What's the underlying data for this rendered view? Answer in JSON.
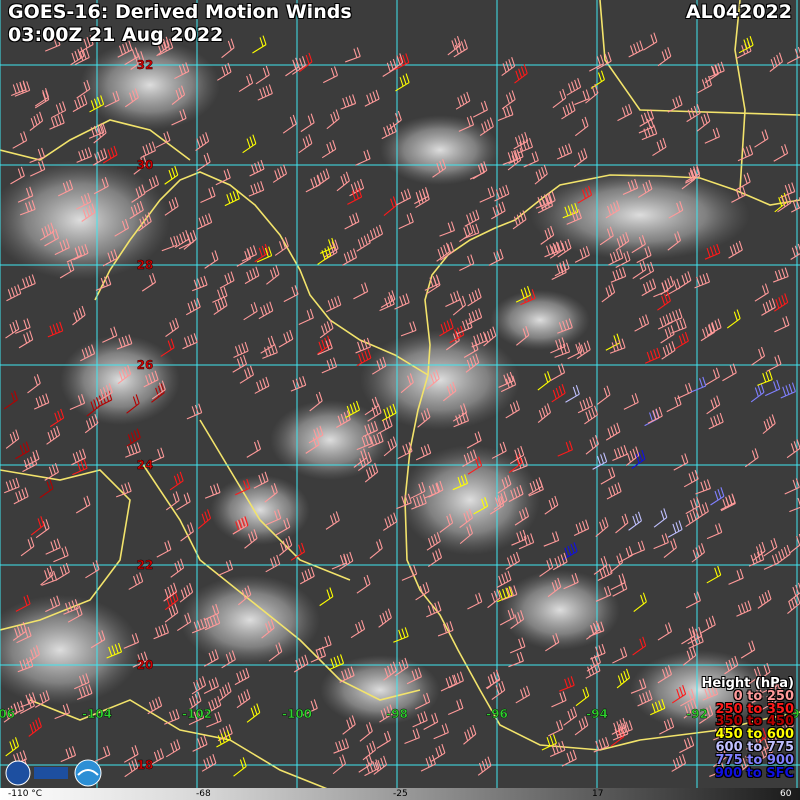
{
  "header": {
    "title": "GOES-16: Derived Motion Winds",
    "time": "03:00Z 21 Aug 2022",
    "storm_id": "AL042022"
  },
  "map": {
    "lat_labels": [
      "32",
      "30",
      "28",
      "26",
      "24",
      "22",
      "20",
      "18"
    ],
    "lon_labels": [
      "-106",
      "-104",
      "-102",
      "-100",
      "-98",
      "-96",
      "-94",
      "-92",
      "-90"
    ],
    "grid_color": "#41e6f0",
    "coast_color": "#f2e36b",
    "lat_label_color": "#d10000",
    "lon_label_color": "#2fd32f"
  },
  "legend": {
    "title": "Height (hPa)",
    "items": [
      {
        "label": "0 to 250",
        "color": "#ff9a9a"
      },
      {
        "label": "250 to 350",
        "color": "#ff1a1a"
      },
      {
        "label": "350 to 450",
        "color": "#b30000"
      },
      {
        "label": "450 to 600",
        "color": "#ffff00"
      },
      {
        "label": "600 to 775",
        "color": "#c0c0ff"
      },
      {
        "label": "775 to 900",
        "color": "#8080ff"
      },
      {
        "label": "900 to SFC",
        "color": "#1010e0"
      }
    ]
  },
  "colorbar": {
    "ticks": [
      "-110 °C",
      "-68",
      "-25",
      "17",
      "60"
    ]
  }
}
